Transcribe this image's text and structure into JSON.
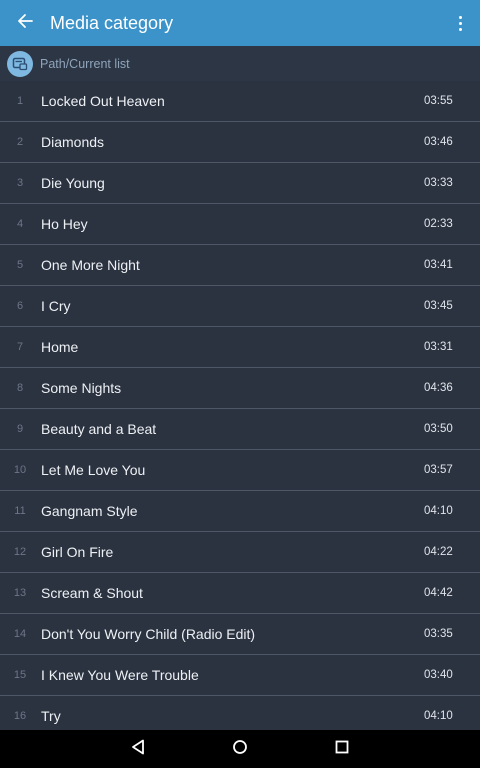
{
  "header": {
    "title": "Media category",
    "back_icon": "arrow-back-icon",
    "menu_icon": "more-vert-icon",
    "bar_color": "#3b93c9"
  },
  "pathbar": {
    "label": "Path/Current list",
    "icon": "playlist-folder-icon"
  },
  "tracks": [
    {
      "index": "1",
      "title": "Locked Out Heaven",
      "duration": "03:55"
    },
    {
      "index": "2",
      "title": "Diamonds",
      "duration": "03:46"
    },
    {
      "index": "3",
      "title": "Die Young",
      "duration": "03:33"
    },
    {
      "index": "4",
      "title": "Ho Hey",
      "duration": "02:33"
    },
    {
      "index": "5",
      "title": "One More Night",
      "duration": "03:41"
    },
    {
      "index": "6",
      "title": "I Cry",
      "duration": "03:45"
    },
    {
      "index": "7",
      "title": "Home",
      "duration": "03:31"
    },
    {
      "index": "8",
      "title": "Some Nights",
      "duration": "04:36"
    },
    {
      "index": "9",
      "title": "Beauty and a Beat",
      "duration": "03:50"
    },
    {
      "index": "10",
      "title": "Let Me Love You",
      "duration": "03:57"
    },
    {
      "index": "11",
      "title": "Gangnam Style",
      "duration": "04:10"
    },
    {
      "index": "12",
      "title": "Girl On Fire",
      "duration": "04:22"
    },
    {
      "index": "13",
      "title": "Scream & Shout",
      "duration": "04:42"
    },
    {
      "index": "14",
      "title": "Don't You Worry Child (Radio Edit)",
      "duration": "03:35"
    },
    {
      "index": "15",
      "title": "I Knew You Were Trouble",
      "duration": "03:40"
    },
    {
      "index": "16",
      "title": "Try",
      "duration": "04:10"
    }
  ],
  "navbar": {
    "back_icon": "nav-back-icon",
    "home_icon": "nav-home-icon",
    "recents_icon": "nav-recents-icon"
  }
}
